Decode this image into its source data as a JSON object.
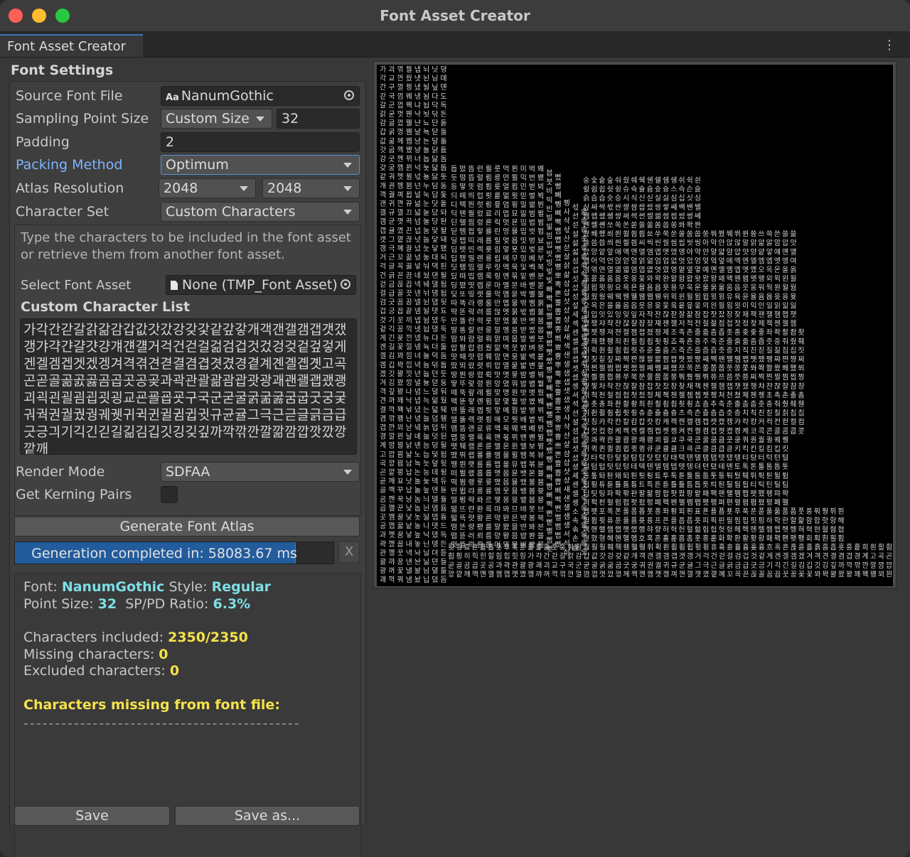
{
  "window": {
    "title": "Font Asset Creator"
  },
  "tab": {
    "label": "Font Asset Creator",
    "menu_icon": "kebab-menu-icon"
  },
  "settings": {
    "section_title": "Font Settings",
    "source_font_file": {
      "label": "Source Font File",
      "value": "NanumGothic",
      "icon": "font-aa-icon"
    },
    "sampling_point_size": {
      "label": "Sampling Point Size",
      "mode": "Custom Size",
      "value": "32"
    },
    "padding": {
      "label": "Padding",
      "value": "2"
    },
    "packing_method": {
      "label": "Packing Method",
      "value": "Optimum"
    },
    "atlas_resolution": {
      "label": "Atlas Resolution",
      "width": "2048",
      "height": "2048"
    },
    "character_set": {
      "label": "Character Set",
      "value": "Custom Characters"
    },
    "help_text": "Type the characters to be included in the font asset or retrieve them from another font asset.",
    "select_font_asset": {
      "label": "Select Font Asset",
      "value": "None (TMP_Font Asset)"
    },
    "custom_character_list": {
      "label": "Custom Character List",
      "value": "가각간갇갈갉갊감갑값갓갔강갖갗같갚갛개객갠갤갬갭갯갰갱갸갹갼걀걋걍걔걘걜거걱건걷걸걺검겁것겄겅겆겉겊겋게겐겔겜겝겟겠겡겨격겪견겯결겸겹겻겼경곁계곈곌곕곗고곡곤곧골곪곬곯곰곱곳공곶과곽관괄괆괌괍괏광괘괜괠괩괬괭괴괵괸괼굄굅굇굉교굔굘굡굣구국군굳굴굵굶굻굼굽굿궁궂궈궉권궐궜궝궤궷귀귁귄귈귐귑귓규균귤그극근귿글긁금급긋긍긔기긱긴긷길긺김깁깃깅깆깊까깍깎깐깔깖깜깝깟깠깡깥깨"
    },
    "render_mode": {
      "label": "Render Mode",
      "value": "SDFAA"
    },
    "get_kerning_pairs": {
      "label": "Get Kerning Pairs",
      "checked": false
    },
    "generate_button": "Generate Font Atlas",
    "progress": {
      "text": "Generation completed in: 58083.67 ms",
      "fraction": 0.88,
      "cancel": "X"
    }
  },
  "info": {
    "font_label": "Font:",
    "font_value": "NanumGothic",
    "style_label": "Style:",
    "style_value": "Regular",
    "point_size_label": "Point Size:",
    "point_size_value": "32",
    "ratio_label": "SP/PD Ratio:",
    "ratio_value": "6.3%",
    "included_label": "Characters included:",
    "included_value": "2350/2350",
    "missing_label": "Missing characters:",
    "missing_value": "0",
    "excluded_label": "Excluded characters:",
    "excluded_value": "0",
    "missing_from_file": "Characters missing from font file:",
    "dashes": "--------------------------------------------"
  },
  "buttons": {
    "save": "Save",
    "save_as": "Save as..."
  },
  "atlas_preview": {
    "background": "#000000",
    "glyph_color": "#d0d0d0",
    "glyph_set": "가각간갇갈갉감갑값갓강갖같개객갠갤갬갭갯갱거걱건걷걸검겁것겉게겐겔겜겠겨격견결겸겹경계고곡곤곧골곰곱곳공과곽관괄광괘괴교구국군굳굴굵굶굽굿궁궈권궐귀규균귤그극근글긁금급긋긍기긱긴길김깁깃깅깊까깍깎깐깔깜깝깡깥깨깩깬깰깸깹깻깼깽꺄꺼꺽꺾껀껄껌껍껏껐껑께껙껜껨껫껭껴껸껼꼇꼈꼍꼐꼬꼭꼰꼲꼴꼼꼽꼿꽁꽂꽃꽈꽉꽐꽜꽝꽤꽥꽹꾀꾄꾈꾐꾑꾕꾜꾸꾹꾼꿀꿇꿈꿉꿋꿍꿎꿔꿜꿨꿩꿰꿱꿴꿸뀀뀁뀄뀌뀐뀔뀜뀝뀨끄끅끈끊끌끎끓끔끕끗끙끝끼끽낀낄낌낍낏낑나낙낚난낟날낡낢남납낫났낭낮낯낱낳내낵낸낼냄냅냇냈냉냐냑냔냘냠냥너넉넋넌널넒넓넘넙넛넜넝넣네넥넨넬넴넵넷넸넹녀녁년녈념녑녔녕녘녜녠노녹논놀놂놈놉놋농높놓놔놘놜놨뇌뇐뇔뇜뇝뇟뇨뇩뇬뇰뇹뇻뇽누눅눈눋눌눔눕눗눙눠눴눼뉘뉜뉠뉨뉩뉴뉵뉼늄늅늉느늑는늘늙늚늠늡늣능늦늪늬늰늴니닉닌닐닒님닙닛닝닢다닥닦단닫달닭닮닯닳담답닷닸당닺닻닿대댁댄댈댐댑댓댔댕댜더덕덖던덛덜덞덟덤덥덧덩덫덮데덱덴델뎀뎁뎃뎄뎅뎌뎐뎔뎠뎡뎨뎬도독돈돋돌돎돐돔돕돗동돛돝돠돤돨돼됐되된될됨됩됫됴두둑둔둘둠둡둣둥둬뒀뒈뒝뒤뒨뒬뒵뒷뒹듀듄듈듐듕드득든듣들듦듬듭듯등듸디딕딘딛딜딤딥딧딨딩딪따딱딴딸땀땁땃땄땅땋때땍땐땔땜땝땟땠땡떠떡떤떨떪떫떰떱떳떴떵떻떼떽뗀뗄뗌뗍뗏뗐뗑뗘뗬또똑똔똘똥똬똴뙈뙤뙨뚜뚝뚠뚤뚫뚬뚱뛔뛰뛴뛸뜀뜁뜅뜨뜩뜬뜯뜰뜸뜹뜻띄띈띌띔띕띠띤띨띰띱띳띵라락란랄람랍랏랐랑랒랖랗래랙랜랠램랩랫랬랭랴략랸럇량러럭런럴럼럽럿렀렁렇레렉렌렐렘렙렛렝려력련렬렴렵렷렸령례롄롑롓로록론롤롬롭롯롱롸롼뢍뢨뢰뢴뢸룀룁룃룅료룐룔룝룟룡루룩룬룰룸룹룻룽뤄뤘뤠뤼뤽륀륄륌륏륑류륙륜률륨륩륫륭르륵른를름릅릇릉릊릍릎리릭린릴림립릿링마막만많맏말맑맒맘맙맛망맞맡맣매맥맨맬맴맵맷맸맹맺먀먁먈먕머먹먼멀멂멈멉멋멍멎멓메멕멘멜멤멥멧멨멩며멱면멸몃몄명몇몌모목몫몬몰몲몸몹못몽뫄뫈뫘뫙뫼묀묄묍묏묑묘묜묠묩묫무묵묶문묻물묽묾뭄뭅뭇뭉뭍뭏뭐뭔뭘뭡뭣뭬뮈뮌뮐뮤뮨뮬뮴뮷므믄믈믐믓미믹민믿밀밂밈밉밋밌밍및밑바박밖밗반받발밝밞밟밤밥밧방밭배백밴밸뱀뱁뱃뱄뱅뱉뱌뱍뱐뱝버벅번벋벌벎범법벗벙벚베벡벤벧벨벰벱벳벴벵벼벽변별볍볏볐병볕볘볜보복볶본볼봄봅봇봉봐봔봤봬뵀뵈뵉뵌뵐뵘뵙뵤뵨부북분붇불붉붊붐붑붓붕붙붚붜붤붰붸뷔뷕뷘뷜뷩뷰뷴뷸븀븃븅브븍븐블븜븝븟비빅빈빌빎빔빕빗빙빚빛빠빡빤빨빪빰빱빳빴빵빻빼빽뺀뺄뺌뺍뺏뺐뺑뺘뺙뺨뻐뻑뻔뻗뻘뻠뻣뻤뻥뻬뼁뼈뼉뼘뼙뼛뼜뼝뽀뽁뽄뽈뽐뽑뽕뾔뾰뿅뿌뿍뿐뿔뿜뿟뿡쀼쁑쁘쁜쁠쁨쁩삐삑삔삘삠삡삣삥사삭삯산삳살삵삶삼삽삿샀상샅새색샌샐샘샙샛샜생샤샥샨샬샴샵샷샹섀섄섈섐섕서석섞섟선섣설섦섧섬섭섯섰성섶세섹센셀셈셉셋셌셍셔셕션셜셤셥셧셨셩셰셴셸솅소속솎손솔솖솜솝솟송솥솨솩솬솰솽쇄쇈쇌쇔쇗쇘쇠쇤쇨쇰쇱쇳쇼쇽숀숄숌숍숏숑수숙순숟술숨숩숫숭숯숱숲숴쉈쉐쉑쉔쉘쉠쉥쉬쉭쉰쉴쉼쉽쉿슁슈슉슐슘슛슝스슥슨슬슭슴습슷승시식신싣실싫심십싯싱싶싸싹싻싼쌀쌈쌉쌌쌍쌓쌔쌕쌘쌜쌤쌥쌨쌩썅써썩썬썰썲썸썹썼썽쎄쎈쎌쏀쏘쏙쏜쏟쏠쏢쏨쏩쏭쏴쏵쏸쐈쐐쐤쐬쐰쐴쐼쐽쑈쑤쑥쑨쑬쑴쑵쑹쒀쒔쒜쒸쒼쓩쓰쓱쓴쓸쓺쓿씀씁씌씐씔씜씨씩씬씰씸씹씻씽아악안앉않알앍앎앓암압앗았앙앝앞애액앤앨앰앱앳앴앵야약얀얄얇얌얍얏양얕얗얘얜얠얩어억언얹얻얼얽얾엄업없엇었엉엊엌엎에엑엔엘엠엡엣엥여역엮연열엶엷염엽엾엿였영옅옆옇예옌옐옘옙옛옜오옥온올옭옮옰옳옴옵옷옹옻와왁완왈왐왑왓왔왕왜왝왠왬왯왱외왹왼욀욈욉욋욍요욕욘욜욤욥욧용우욱운울욹욺움웁웃웅워웍원월웜웝웠웡웨웩웬웰웸웹웽위윅윈윌윔윕윗윙유육윤율윰윱윳융윷으윽은을읊음읍읏응읒읓읔읕읖읗의읜읠읨읫이익인일읽읾잃임입잇있잉잊잎자작잔잖잗잘잚잠잡잣잤장잦재잭잰잴잼잽잿쟀쟁쟈쟉쟌쟎쟐쟘쟝쟤쟨쟬저적전절젊점접젓정젖제젝젠젤젬젭젯젱져젼졀졈졉졌졍졔조족존졸졺좀좁좃종좆좇좋좌좍좔좝좟좡좨좼좽죄죈죌죔죕죗죙죠죡죤죵주죽준줄줅줆줌줍줏중줘줬줴쥐쥑쥔쥘쥠쥡쥣쥬쥰쥴쥼즈즉즌즐즘즙즛증지직진짇질짊짐집짓징짖짙짚짜짝짠짢짤짧짬짭짯짰짱째짹짼쨀쨈쨉쨋쨌쨍쨔쨘쨩쩌쩍쩐쩔쩜쩝쩟쩠쩡쩨쩽쪄쪘쪼쪽쫀쫄쫌쫍쫏쫑쫓쫘쫙쫠쫬쫴쬈쬐쬔쬘쬠쬡쭁쭈쭉쭌쭐쭘쭙쭝쭤쭸쭹쮜쮸쯔쯤쯧쯩찌찍찐찔찜찝찡찢찧차착찬찮찰참찹찻찼창찾채책챈챌챔챕챗챘챙챠챤챦챨챰챵처척천철첨첩첫첬청체첵첸첼쳄쳅쳇쳉쳐쳔쳤쳬쳰촁초촉촌촐촘촙촛총촤촨촬촹최쵠쵤쵬쵭쵯쵱쵸춈추축춘출춤춥춧충춰췄췌췐취췬췰췸췹췻췽츄츈츌츔츙츠측츤츨츰츱츳층치칙친칟칠칡침칩칫칭카칵칸칼캄캅캇캉캐캑캔캘캠캡캣캤캥캬캭컁커컥컨컫컬컴컵컷컸컹케켁켄켈켐켑켓켕켜켠켤켬켭켯켰켱켸코콕콘콜콤콥콧콩콰콱콴콸쾀쾅쾌쾡쾨쾰쿄쿠쿡쿤쿨쿰쿱쿳쿵쿼퀀퀄퀑퀘퀭퀴퀵퀸퀼큄큅큇큉큐큔큘큠크큭큰클큼큽킁키킥킨킬킴킵킷킹타탁탄탈탉탐탑탓탔탕태택탠탤탬탭탯탰탱탸턍터턱턴털턺텀텁텃텄텅테텍텐텔템텝텟텡텨텬텼톄톈토톡톤톨톰톱톳통톺톼퇀퇘퇴퇸툇툉툐투툭툰툴툼툽툿퉁퉈퉜퉤튀튁튄튈튐튑튕튜튠튤튬튱트특튼튿틀틂틈틉틋틔틘틜틤틥티틱틴틸팀팁팃팅파팍팎판팔팖팜팝팟팠팡팥패팩팬팰팸팹팻팼팽퍄퍅퍼퍽펀펄펌펍펏펐펑페펙펜펠펨펩펫펭펴편펼폄폅폈평폐폘폡폣포폭폰폴폼폽폿퐁퐈퐝푀푄표푠푤푭푯푸푹푼푿풀풂품풉풋풍풔풩퓌퓐퓔퓜퓟퓨퓬퓰퓸퓻퓽프픈플픔픕픗피픽핀필핌핍핏핑하학한할핥함합핫항해핵핸핼햄햅햇했행햐향허헉헌헐헒험헙헛헝헤헥헨헬헴헵헷헹혀혁현혈혐협혓혔형혜혠혤혭호혹혼홀홅홈홉홋홍홑화확환활홧황홰홱홴횃횅회획횐횔횝횟횡효횬횰횹횻후훅훈훌훑훔훗훙훠훤훨훰훵훼훽휀휄휑휘휙휜휠휨휩휫휭휴휵휸휼흄흇흉흐흑흔흖흗흘흙흠흡흣흥흩희흰흴흼흽힁히힉힌힐힘힙힛힝"
  }
}
